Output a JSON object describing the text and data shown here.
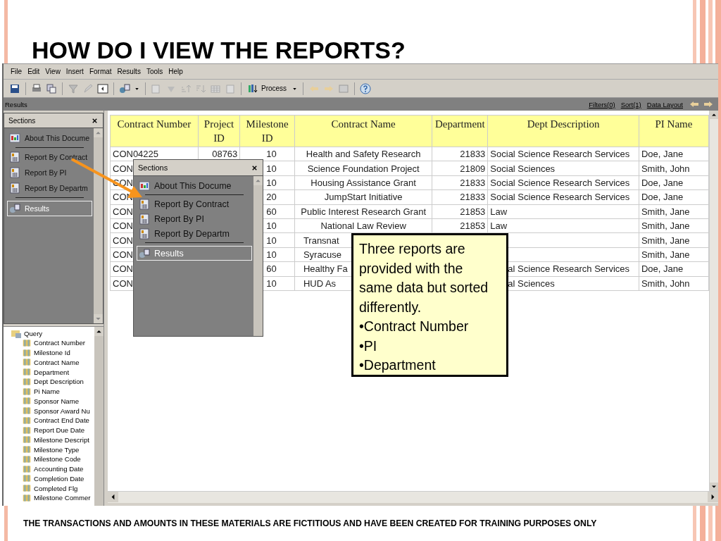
{
  "slide_title": "HOW DO I VIEW THE REPORTS?",
  "menu": [
    "File",
    "Edit",
    "View",
    "Insert",
    "Format",
    "Results",
    "Tools",
    "Help"
  ],
  "toolbar": {
    "process_label": "Process"
  },
  "results_bar": {
    "title": "Results",
    "links": [
      "Filters(0)",
      "Sort(1)",
      "Data Layout"
    ]
  },
  "sections_panels": [
    {
      "title": "Sections",
      "items": [
        {
          "kind": "about",
          "label": "About This Docume",
          "selected": false
        },
        {
          "kind": "report",
          "label": "Report By Contract",
          "selected": false
        },
        {
          "kind": "report",
          "label": "Report By PI",
          "selected": false
        },
        {
          "kind": "report",
          "label": "Report By Departm",
          "selected": false
        },
        {
          "kind": "results",
          "label": "Results",
          "selected": true
        }
      ]
    },
    {
      "title": "Sections",
      "items": [
        {
          "kind": "about",
          "label": "About This Docume",
          "selected": false
        },
        {
          "kind": "report",
          "label": "Report By Contract",
          "selected": false
        },
        {
          "kind": "report",
          "label": "Report By PI",
          "selected": false
        },
        {
          "kind": "report",
          "label": "Report By Departm",
          "selected": false
        },
        {
          "kind": "results",
          "label": "Results",
          "selected": true
        }
      ]
    }
  ],
  "query_tree": {
    "label": "Query",
    "children": [
      {
        "label": "Contract Number"
      },
      {
        "label": "Milestone Id"
      },
      {
        "label": "Contract Name"
      },
      {
        "label": "Department"
      },
      {
        "label": "Dept Description"
      },
      {
        "label": "Pi Name"
      },
      {
        "label": "Sponsor Name"
      },
      {
        "label": "Sponsor Award Nu"
      },
      {
        "label": "Contract End Date"
      },
      {
        "label": "Report Due Date"
      },
      {
        "label": "Milestone Descript"
      },
      {
        "label": "Milestone Type"
      },
      {
        "label": "Milestone Code"
      },
      {
        "label": "Accounting Date"
      },
      {
        "label": "Completion Date"
      },
      {
        "label": "Completed Flg"
      },
      {
        "label": "Milestone Commer"
      }
    ]
  },
  "table": {
    "columns": [
      "Contract Number",
      "Project ID",
      "Milestone ID",
      "Contract Name",
      "Department",
      "Dept Description",
      "PI Name"
    ],
    "rows": [
      [
        "CON04225",
        "08763",
        "10",
        "Health and Safety Research",
        "21833",
        "Social Science Research Services",
        "Doe, Jane"
      ],
      [
        "CON",
        null,
        "10",
        "Science Foundation Project",
        "21809",
        "Social Sciences",
        "Smith, John"
      ],
      [
        "CON",
        null,
        "10",
        "Housing Assistance Grant",
        "21833",
        "Social Science Research Services",
        "Doe, Jane"
      ],
      [
        "CON",
        null,
        "20",
        "JumpStart Initiative",
        "21833",
        "Social Science Research Services",
        "Doe, Jane"
      ],
      [
        "CON",
        null,
        "60",
        "Public Interest Research Grant",
        "21853",
        "Law",
        "Smith, Jane"
      ],
      [
        "CON",
        null,
        "10",
        "National Law Review",
        "21853",
        "Law",
        "Smith, Jane"
      ],
      [
        "CON",
        null,
        "10",
        "Transnat",
        null,
        null,
        "Smith, Jane"
      ],
      [
        "CON",
        null,
        "10",
        "Syracuse",
        null,
        null,
        "Smith, Jane"
      ],
      [
        "CON",
        null,
        "60",
        "Healthy Fa",
        null,
        "al Science Research Services",
        "Doe, Jane"
      ],
      [
        "CON",
        null,
        "10",
        "HUD As",
        null,
        "al Sciences",
        "Smith, John"
      ]
    ]
  },
  "callout": {
    "text": "Three reports are provided with the same data but sorted differently.",
    "bullets": [
      "•Contract Number",
      "•PI",
      "•Department"
    ]
  },
  "footer": "THE TRANSACTIONS AND AMOUNTS IN THESE MATERIALS ARE FICTITIOUS AND HAVE BEEN CREATED FOR TRAINING PURPOSES ONLY"
}
